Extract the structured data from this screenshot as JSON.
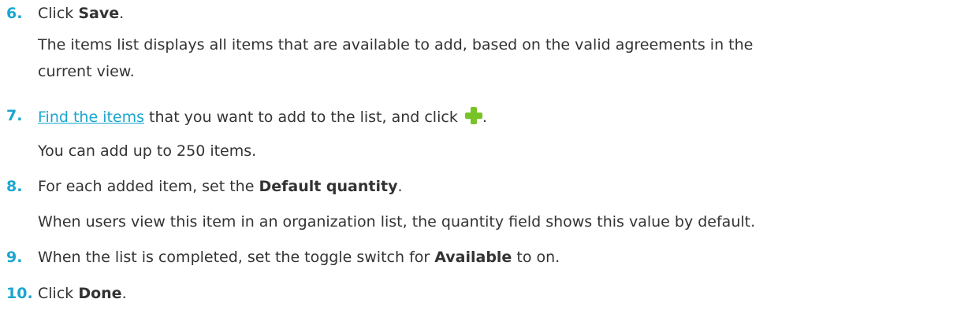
{
  "steps": [
    {
      "number": "6.",
      "pre": "Click ",
      "bold": "Save",
      "post": ".",
      "detail_lines": [
        "The items list displays all items that are available to add, based on the valid agreements in the",
        "current view."
      ]
    },
    {
      "number": "7.",
      "link_text": "Find the items",
      "post_link": " that you want to add to the list, and click ",
      "icon": "plus-icon",
      "icon_color": "#78c325",
      "end": ".",
      "detail": "You can add up to 250 items."
    },
    {
      "number": "8.",
      "pre": "For each added item, set the ",
      "bold": "Default quantity",
      "post": ".",
      "detail": "When users view this item in an organization list, the quantity field shows this value by default."
    },
    {
      "number": "9.",
      "pre": "When the list is completed, set the toggle switch for ",
      "bold": "Available",
      "post": " to on."
    },
    {
      "number": "10.",
      "pre": "Click ",
      "bold": "Done",
      "post": "."
    }
  ],
  "colors": {
    "step_number": "#1aa6cf",
    "link": "#1aa6cf",
    "text": "#333333"
  }
}
